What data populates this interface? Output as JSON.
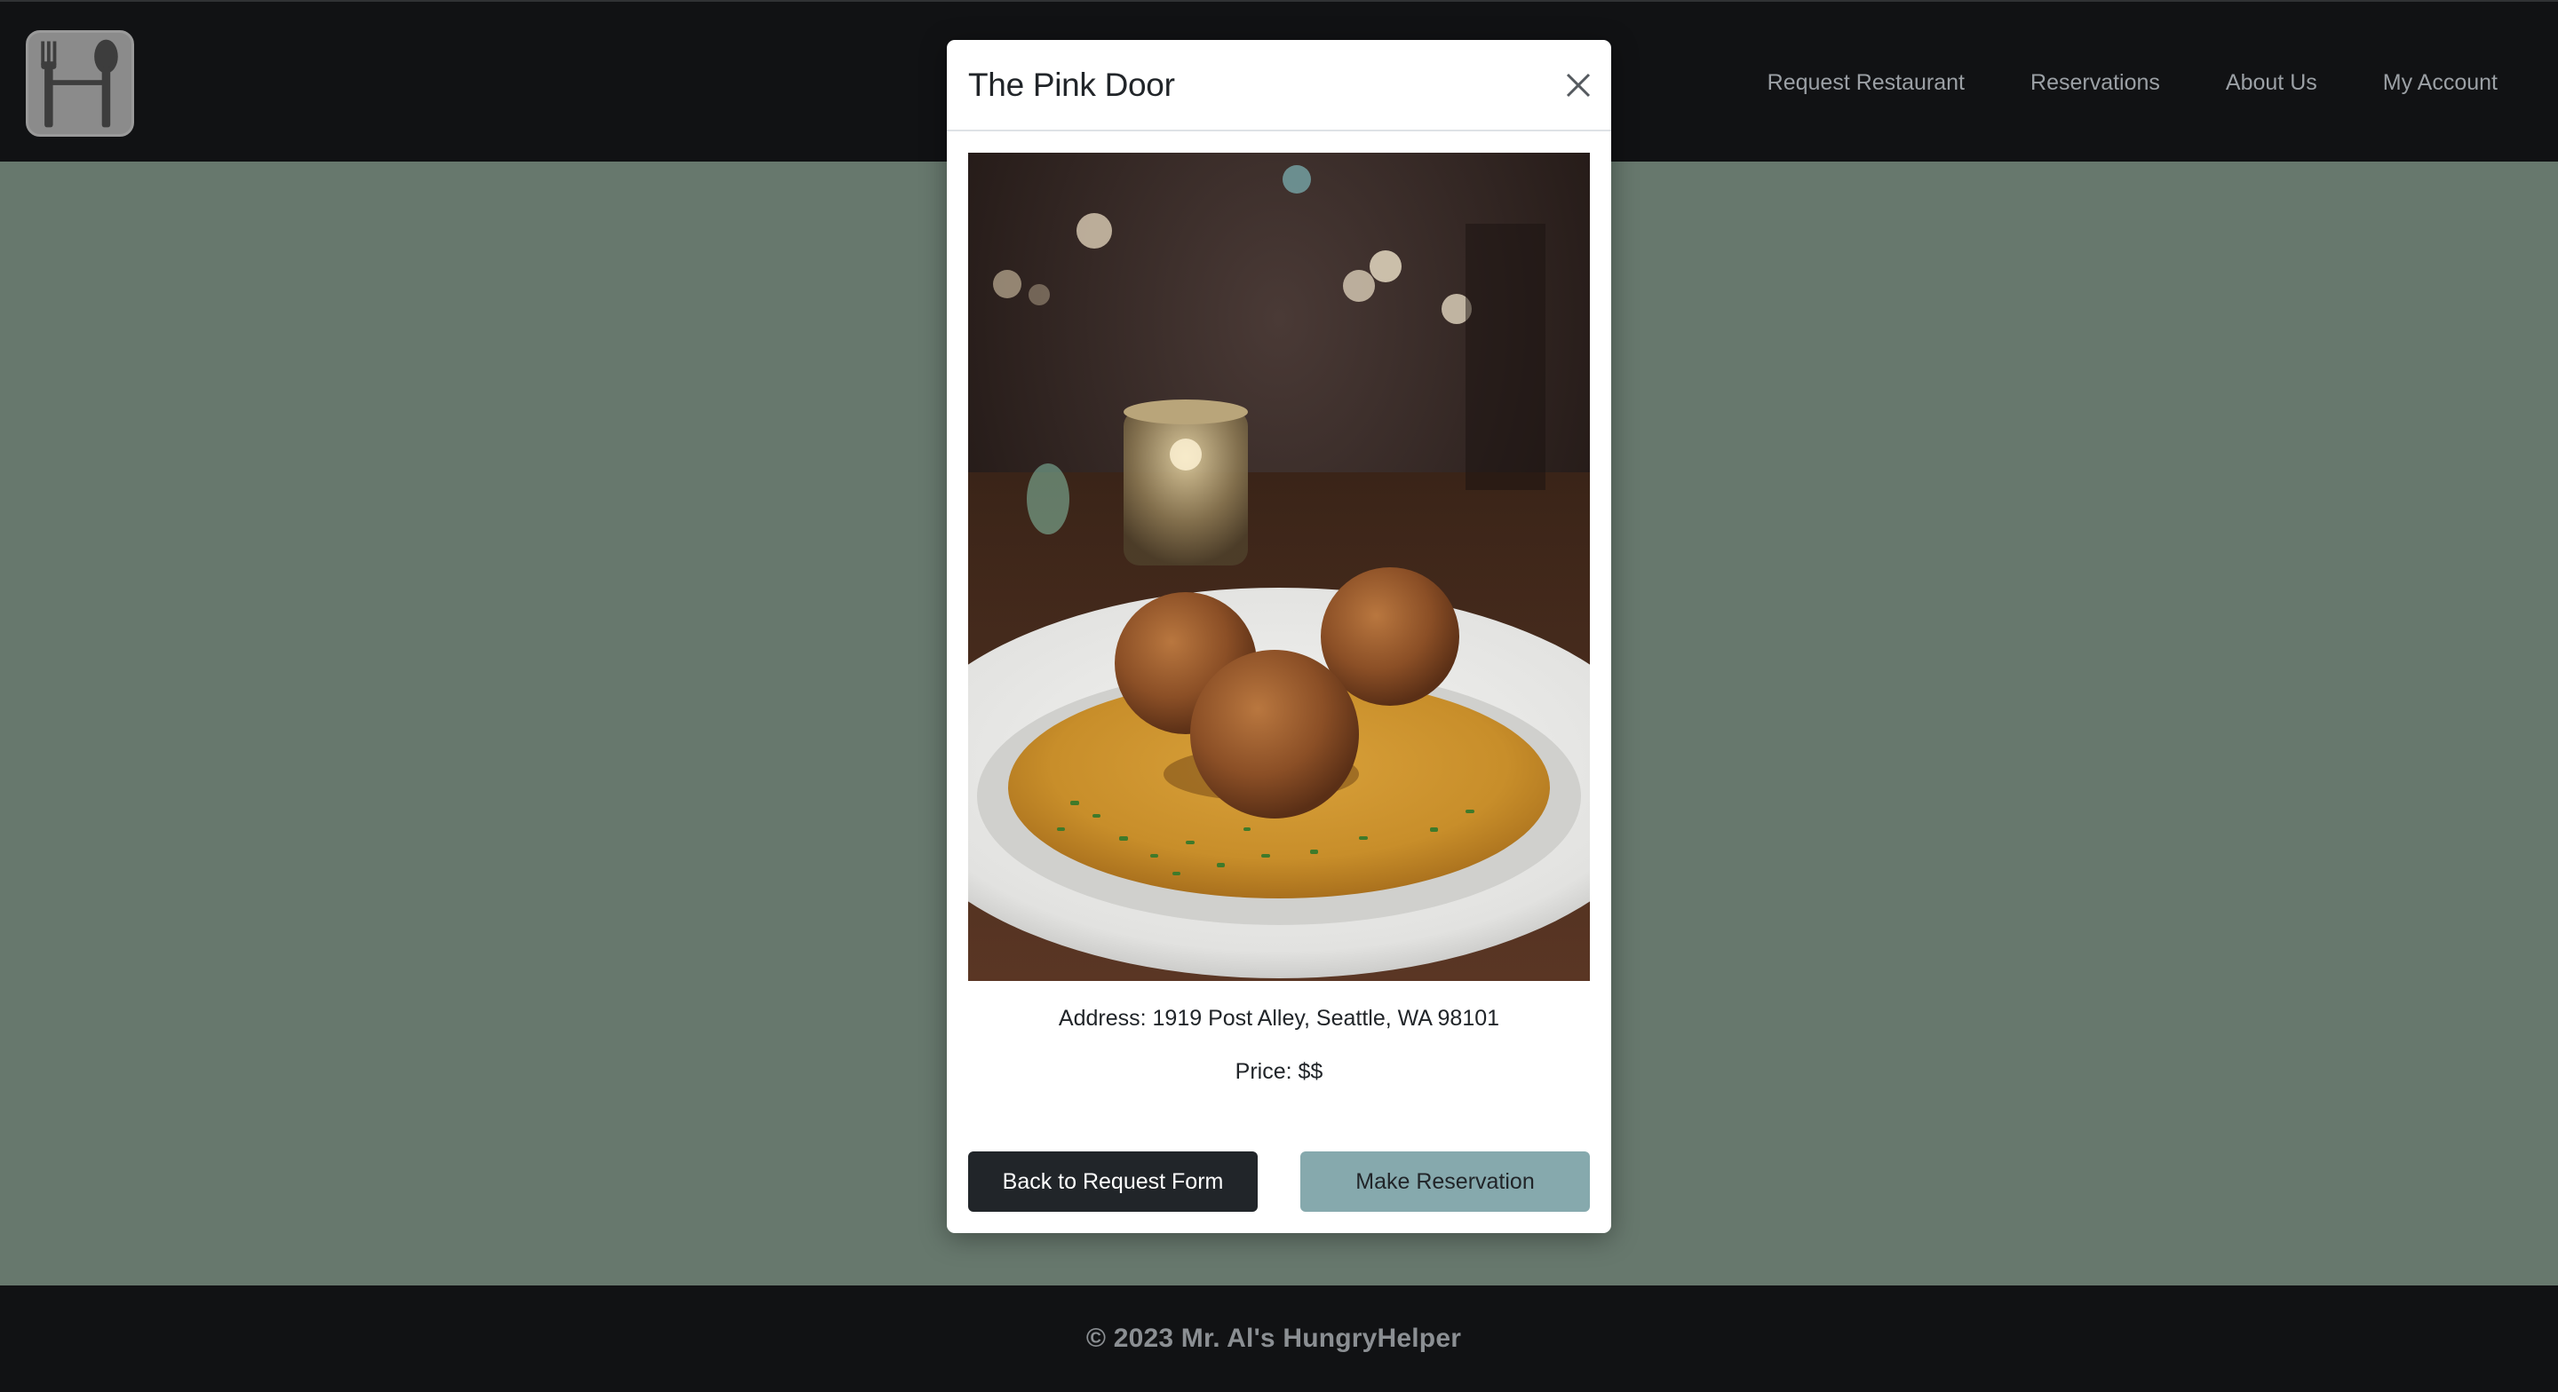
{
  "navbar": {
    "logo_icon": "fork-spoon-h-logo-icon",
    "links": [
      {
        "label": "Request Restaurant"
      },
      {
        "label": "Reservations"
      },
      {
        "label": "About Us"
      },
      {
        "label": "My Account"
      }
    ]
  },
  "modal": {
    "title": "The Pink Door",
    "close_icon": "close-icon",
    "photo_icon": "restaurant-dish-photo",
    "address": "Address: 1919 Post Alley, Seattle, WA 98101",
    "price": "Price: $$",
    "back_button": "Back to Request Form",
    "reserve_button": "Make Reservation"
  },
  "footer": {
    "copyright": "© 2023 Mr. Al's HungryHelper"
  },
  "colors": {
    "navbar_bg": "#111214",
    "page_bg": "#67786d",
    "primary_dark": "#212529",
    "reserve_accent": "#86a9ad"
  }
}
